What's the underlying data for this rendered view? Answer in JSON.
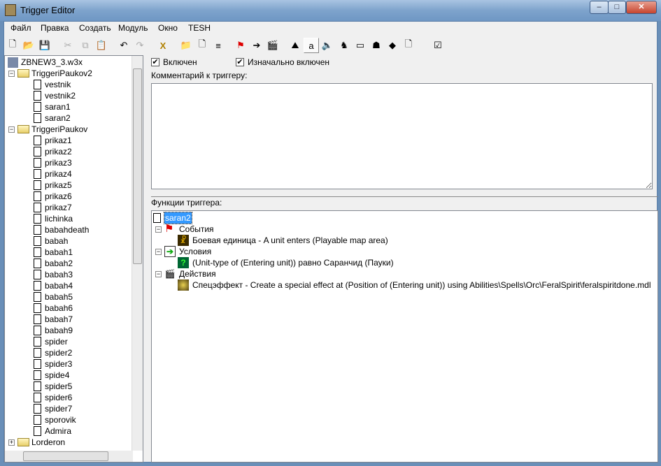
{
  "window": {
    "title": "Trigger Editor",
    "minimize": "–",
    "maximize": "□",
    "close": "✕"
  },
  "menu": [
    "Файл",
    "Правка",
    "Создать",
    "Модуль",
    "Окно",
    "TESH"
  ],
  "toolbar": [
    {
      "name": "new-icon",
      "glyph": "🗋"
    },
    {
      "name": "open-icon",
      "glyph": "📂"
    },
    {
      "name": "save-icon",
      "glyph": "💾"
    },
    {
      "name": "cut-icon",
      "glyph": "✂"
    },
    {
      "name": "copy-icon",
      "glyph": "⧉"
    },
    {
      "name": "paste-icon",
      "glyph": "📋"
    },
    {
      "name": "undo-icon",
      "glyph": "↶"
    },
    {
      "name": "redo-icon",
      "glyph": "↷"
    },
    {
      "name": "delete-icon",
      "glyph": "X"
    },
    {
      "name": "new-category-icon",
      "glyph": "📁"
    },
    {
      "name": "new-trigger-icon",
      "glyph": "🗋"
    },
    {
      "name": "new-comment-icon",
      "glyph": "≡"
    },
    {
      "name": "new-event-icon",
      "glyph": "⚑"
    },
    {
      "name": "new-condition-icon",
      "glyph": "➔"
    },
    {
      "name": "new-action-icon",
      "glyph": "🎬"
    },
    {
      "name": "terrain-editor-icon",
      "glyph": "⛰"
    },
    {
      "name": "trigger-editor-icon",
      "glyph": "a"
    },
    {
      "name": "sound-editor-icon",
      "glyph": "🔈"
    },
    {
      "name": "object-editor-icon",
      "glyph": "♞"
    },
    {
      "name": "campaign-editor-icon",
      "glyph": "▭"
    },
    {
      "name": "ai-editor-icon",
      "glyph": "☗"
    },
    {
      "name": "object-manager-icon",
      "glyph": "◆"
    },
    {
      "name": "import-manager-icon",
      "glyph": "🗋"
    },
    {
      "name": "test-map-icon",
      "glyph": "☑"
    }
  ],
  "tree": {
    "map": "ZBNEW3_3.w3x",
    "groups": [
      {
        "name": "TriggeriPaukov2",
        "items": [
          "vestnik",
          "vestnik2",
          "saran1",
          "saran2"
        ]
      },
      {
        "name": "TriggeriPaukov",
        "items": [
          "prikaz1",
          "prikaz2",
          "prikaz3",
          "prikaz4",
          "prikaz5",
          "prikaz6",
          "prikaz7",
          "lichinka",
          "babahdeath",
          "babah",
          "babah1",
          "babah2",
          "babah3",
          "babah4",
          "babah5",
          "babah6",
          "babah7",
          "babah9",
          "spider",
          "spider2",
          "spider3",
          "spide4",
          "spider5",
          "spider6",
          "spider7",
          "sporovik",
          "Admira"
        ]
      },
      {
        "name": "Lorderon",
        "items": []
      }
    ]
  },
  "trigger": {
    "enabled_label": "Включен",
    "enabled": true,
    "initially_on_label": "Изначально включен",
    "initially_on": true,
    "comment_label": "Комментарий к триггеру:",
    "comment": "",
    "functions_label": "Функции триггера:",
    "name": "saran2",
    "events_label": "События",
    "event": "Боевая единица - A unit enters (Playable map area)",
    "conditions_label": "Условия",
    "condition": "(Unit-type of (Entering unit)) равно Саранчид (Пауки)",
    "actions_label": "Действия",
    "action": "Спецэффект - Create a special effect at (Position of (Entering unit)) using Abilities\\Spells\\Orc\\FeralSpirit\\feralspiritdone.mdl"
  }
}
